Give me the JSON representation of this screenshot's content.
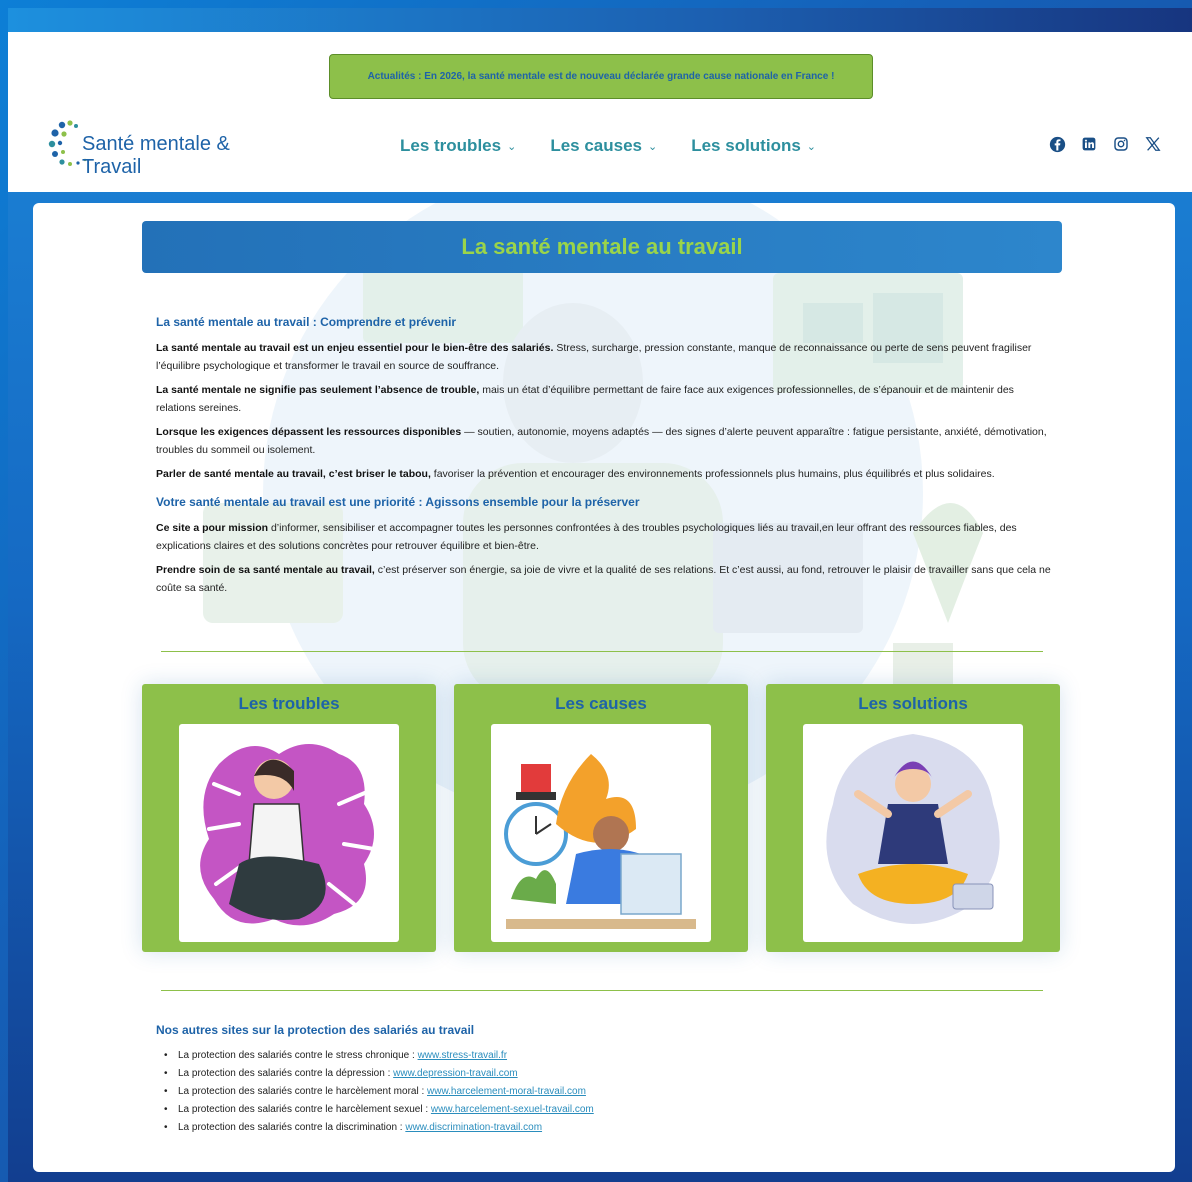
{
  "news": {
    "text": "Actualités : En 2026, la santé mentale est de nouveau déclarée grande cause nationale en France !"
  },
  "brand": {
    "name": "Santé mentale & Travail"
  },
  "nav": [
    {
      "label": "Les troubles"
    },
    {
      "label": "Les causes"
    },
    {
      "label": "Les solutions"
    }
  ],
  "social": [
    "facebook-icon",
    "linkedin-icon",
    "instagram-icon",
    "x-icon"
  ],
  "main": {
    "title": "La santé mentale au travail",
    "section1_heading": "La santé mentale au travail : Comprendre et prévenir",
    "p1_bold": "La santé mentale au travail est un enjeu essentiel pour le bien-être des salariés.",
    "p1_rest": " Stress, surcharge, pression constante, manque de reconnaissance ou perte de sens peuvent fragiliser l’équilibre psychologique et transformer le travail en source de souffrance.",
    "p2_bold": "La santé mentale ne signifie pas seulement l’absence de trouble,",
    "p2_rest": " mais un état d’équilibre permettant de faire face aux exigences professionnelles, de s’épanouir et de maintenir des relations sereines.",
    "p3_bold": "Lorsque les exigences dépassent les ressources disponibles",
    "p3_rest": " — soutien, autonomie, moyens adaptés — des signes d’alerte peuvent apparaître : fatigue persistante, anxiété, démotivation, troubles du sommeil ou isolement.",
    "p4_bold": "Parler de santé mentale au travail, c’est briser le tabou,",
    "p4_rest": " favoriser la prévention et encourager des environnements professionnels plus humains, plus équilibrés et plus solidaires.",
    "section2_heading": "Votre santé mentale au travail est une priorité : Agissons ensemble pour la préserver",
    "p5_bold": "Ce site a pour mission",
    "p5_rest": " d’informer, sensibiliser et accompagner toutes les personnes confrontées à des troubles psychologiques liés au travail,en leur offrant des ressources fiables, des explications claires et des solutions concrètes pour retrouver équilibre et bien-être.",
    "p6_bold": "Prendre soin de sa santé mentale au travail,",
    "p6_rest": " c’est préserver son énergie, sa joie de vivre et la qualité de ses relations. Et c’est aussi, au fond, retrouver le plaisir de travailler sans que cela ne coûte sa santé."
  },
  "tiles": [
    {
      "title": "Les troubles"
    },
    {
      "title": "Les causes"
    },
    {
      "title": "Les solutions"
    }
  ],
  "other_sites": {
    "heading": "Nos autres sites sur la protection des salariés au travail",
    "items": [
      {
        "text": "La protection des salariés contre le stress chronique : ",
        "link": "www.stress-travail.fr"
      },
      {
        "text": "La protection des salariés contre la dépression : ",
        "link": "www.depression-travail.com"
      },
      {
        "text": "La protection des salariés contre le harcèlement moral : ",
        "link": "www.harcelement-moral-travail.com"
      },
      {
        "text": "La protection des salariés contre le harcèlement sexuel : ",
        "link": "www.harcelement-sexuel-travail.com"
      },
      {
        "text": "La protection des salariés contre la discrimination : ",
        "link": "www.discrimination-travail.com"
      }
    ]
  },
  "colors": {
    "primary": "#1e63a8",
    "accent": "#8dc04a",
    "nav": "#2d8f9e"
  }
}
